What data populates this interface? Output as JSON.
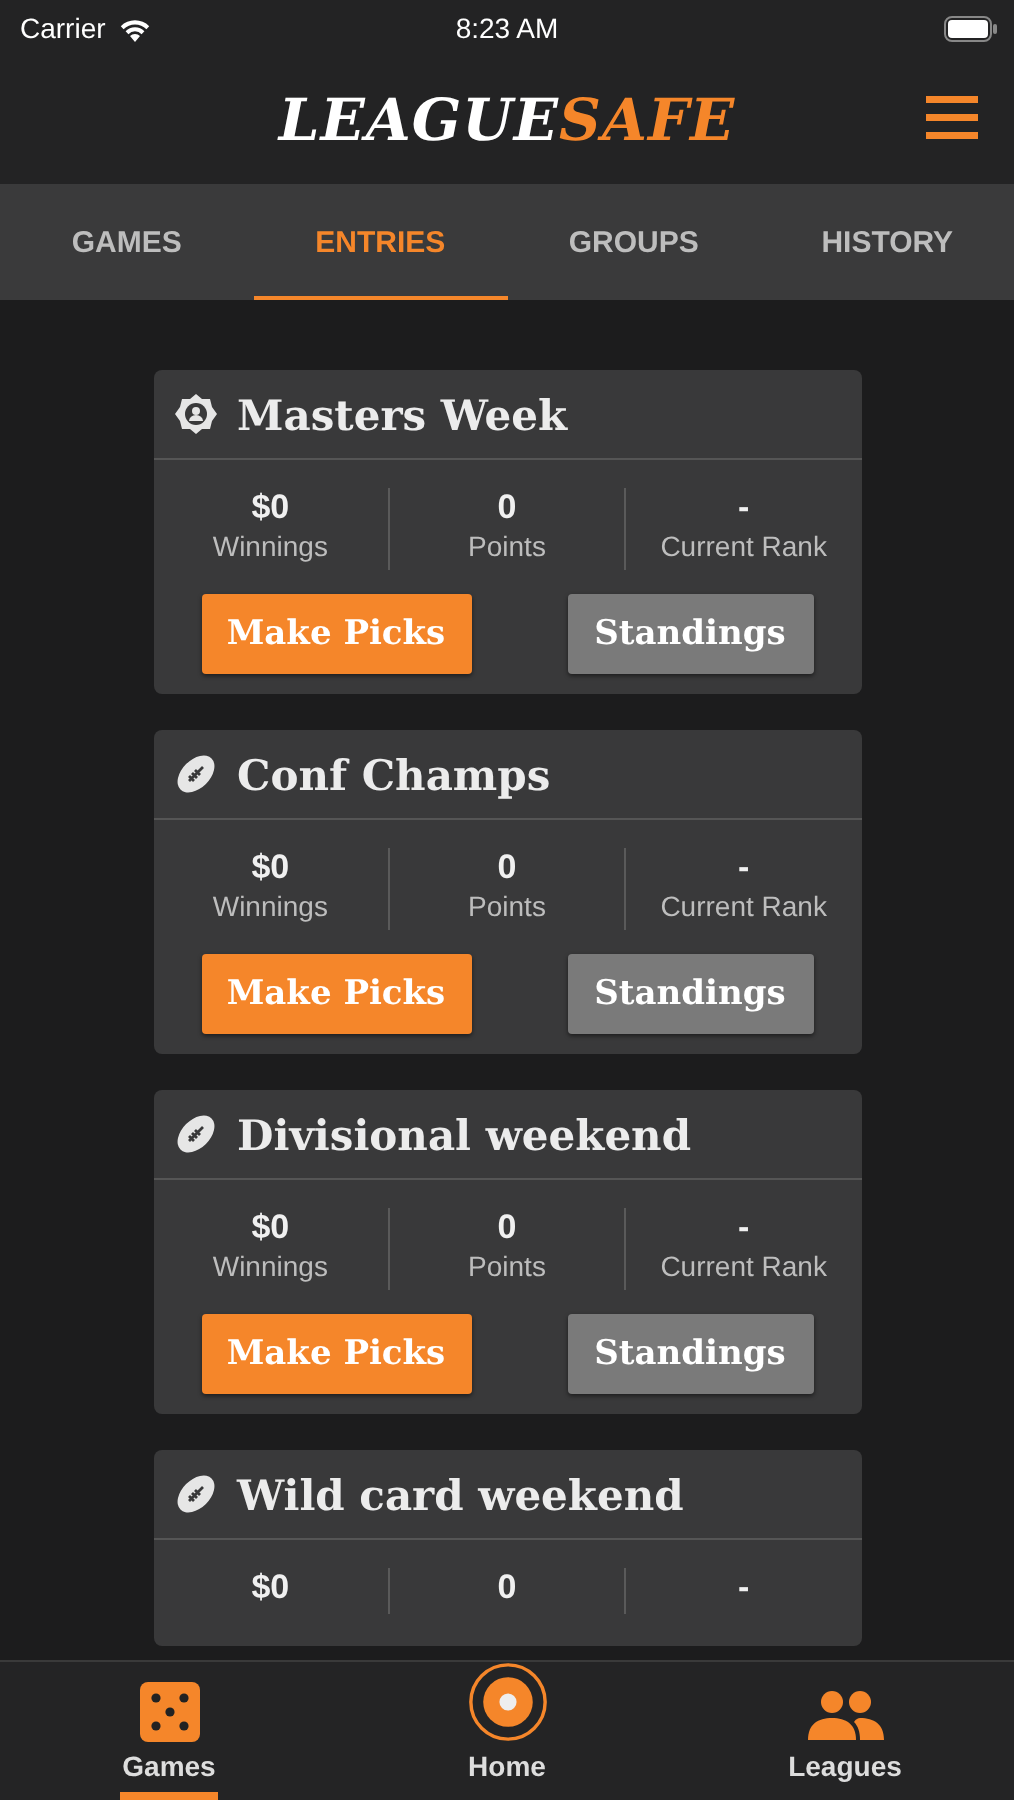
{
  "status_bar": {
    "carrier": "Carrier",
    "time": "8:23 AM"
  },
  "logo": {
    "primary": "LEAGUE",
    "accent": "SAFE"
  },
  "tabs": [
    {
      "label": "GAMES",
      "selected": false
    },
    {
      "label": "ENTRIES",
      "selected": true
    },
    {
      "label": "GROUPS",
      "selected": false
    },
    {
      "label": "HISTORY",
      "selected": false
    }
  ],
  "entries": [
    {
      "kind": "golf",
      "title": "Masters Week",
      "stats": [
        {
          "value": "$0",
          "label": "Winnings"
        },
        {
          "value": "0",
          "label": "Points"
        },
        {
          "value": "-",
          "label": "Current Rank"
        }
      ],
      "buttons": [
        {
          "label": "Make Picks",
          "kind": "primary"
        },
        {
          "label": "Standings",
          "kind": "secondary"
        }
      ]
    },
    {
      "kind": "football",
      "title": "Conf Champs",
      "stats": [
        {
          "value": "$0",
          "label": "Winnings"
        },
        {
          "value": "0",
          "label": "Points"
        },
        {
          "value": "-",
          "label": "Current Rank"
        }
      ],
      "buttons": [
        {
          "label": "Make Picks",
          "kind": "primary"
        },
        {
          "label": "Standings",
          "kind": "secondary"
        }
      ]
    },
    {
      "kind": "football",
      "title": "Divisional weekend",
      "stats": [
        {
          "value": "$0",
          "label": "Winnings"
        },
        {
          "value": "0",
          "label": "Points"
        },
        {
          "value": "-",
          "label": "Current Rank"
        }
      ],
      "buttons": [
        {
          "label": "Make Picks",
          "kind": "primary"
        },
        {
          "label": "Standings",
          "kind": "secondary"
        }
      ]
    },
    {
      "kind": "football",
      "title": "Wild card weekend",
      "stats": [
        {
          "value": "$0"
        },
        {
          "value": "0"
        },
        {
          "value": "-"
        }
      ]
    }
  ],
  "bottom_tabs": [
    {
      "kind": "dice",
      "label": "Games",
      "selected": true
    },
    {
      "kind": "target",
      "label": "Home",
      "selected": false
    },
    {
      "kind": "people",
      "label": "Leagues",
      "selected": false
    }
  ]
}
